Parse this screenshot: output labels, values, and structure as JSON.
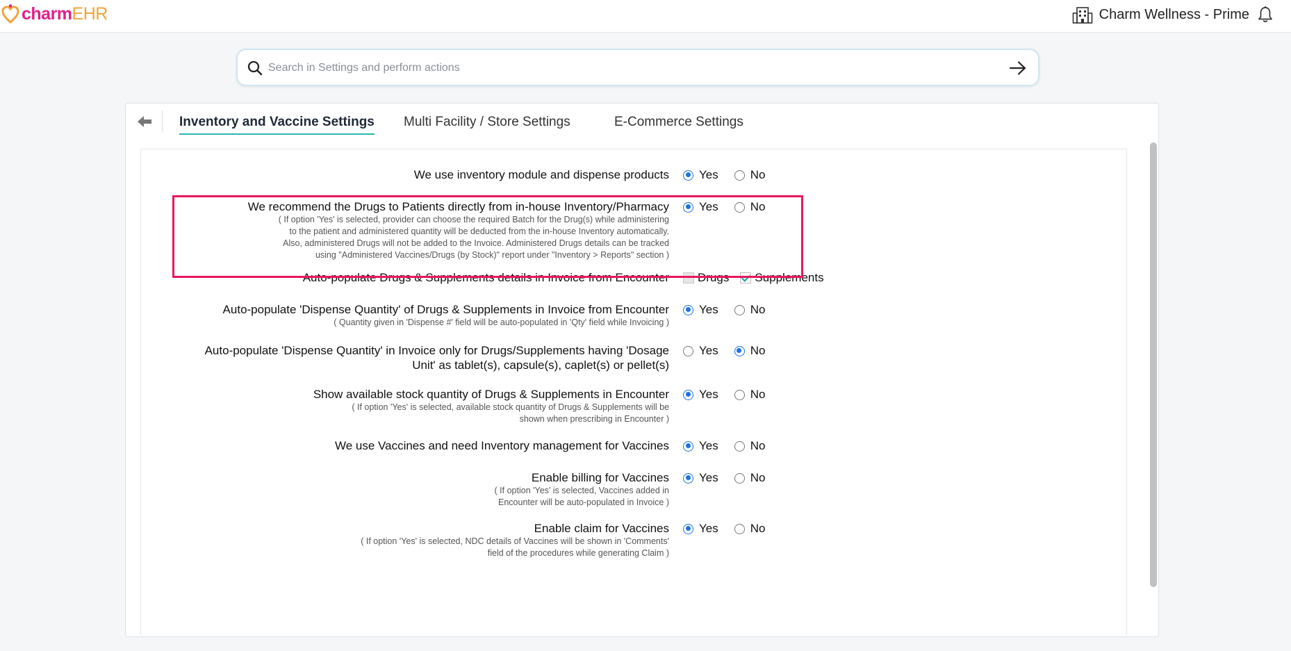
{
  "header": {
    "logo_charm": "charm",
    "logo_ehr": "EHR",
    "facility_name": "Charm Wellness - Prime"
  },
  "search": {
    "placeholder": "Search in Settings and perform actions"
  },
  "tabs": [
    {
      "label": "Inventory and Vaccine Settings",
      "active": true
    },
    {
      "label": "Multi Facility / Store Settings",
      "active": false
    },
    {
      "label": "E-Commerce Settings",
      "active": false
    }
  ],
  "colors": {
    "brand_pink": "#e0218a",
    "brand_orange": "#f2a33a",
    "accent_teal": "#2bb5b1",
    "radio_blue": "#1a73e8",
    "highlight_red": "#e8175d"
  },
  "settings": [
    {
      "question": "We use inventory module and dispense products",
      "note": "",
      "options": [
        "Yes",
        "No"
      ],
      "selected": "Yes"
    },
    {
      "question": "We recommend the Drugs to Patients directly from in-house Inventory/Pharmacy",
      "note_lines": [
        "( If option 'Yes' is selected, provider can choose the required Batch for the Drug(s) while administering",
        "to the patient and administered quantity will be deducted from the in-house Inventory automatically.",
        "Also, administered Drugs will not be added to the Invoice. Administered Drugs details can be tracked",
        "using \"Administered Vaccines/Drugs (by Stock)\" report under \"Inventory > Reports\" section )"
      ],
      "options": [
        "Yes",
        "No"
      ],
      "selected": "Yes",
      "highlighted": true
    },
    {
      "question": "Auto-populate Drugs & Supplements details in Invoice from Encounter",
      "checkboxes": [
        {
          "label": "Drugs",
          "checked": false
        },
        {
          "label": "Supplements",
          "checked": true
        }
      ]
    },
    {
      "question": "Auto-populate 'Dispense Quantity' of Drugs & Supplements in Invoice from Encounter",
      "note_lines": [
        "( Quantity given in 'Dispense #' field will be auto-populated in 'Qty' field while Invoicing )"
      ],
      "options": [
        "Yes",
        "No"
      ],
      "selected": "Yes"
    },
    {
      "question_lines": [
        "Auto-populate 'Dispense Quantity' in Invoice only for Drugs/Supplements having 'Dosage",
        "Unit' as tablet(s), capsule(s), caplet(s) or pellet(s)"
      ],
      "options": [
        "Yes",
        "No"
      ],
      "selected": "No"
    },
    {
      "question": "Show available stock quantity of Drugs & Supplements in Encounter",
      "note_lines": [
        "( If option 'Yes' is selected, available stock quantity of Drugs & Supplements will be",
        "shown when prescribing in Encounter )"
      ],
      "options": [
        "Yes",
        "No"
      ],
      "selected": "Yes"
    },
    {
      "question": "We use Vaccines and need Inventory management for Vaccines",
      "options": [
        "Yes",
        "No"
      ],
      "selected": "Yes"
    },
    {
      "question": "Enable billing for Vaccines",
      "note_lines": [
        "( If option 'Yes' is selected, Vaccines added in",
        "Encounter will be auto-populated in Invoice )"
      ],
      "options": [
        "Yes",
        "No"
      ],
      "selected": "Yes"
    },
    {
      "question": "Enable claim for Vaccines",
      "note_lines": [
        "( If option 'Yes' is selected, NDC details of Vaccines will be shown in 'Comments'",
        "field of the procedures while generating Claim )"
      ],
      "options": [
        "Yes",
        "No"
      ],
      "selected": "Yes"
    }
  ]
}
